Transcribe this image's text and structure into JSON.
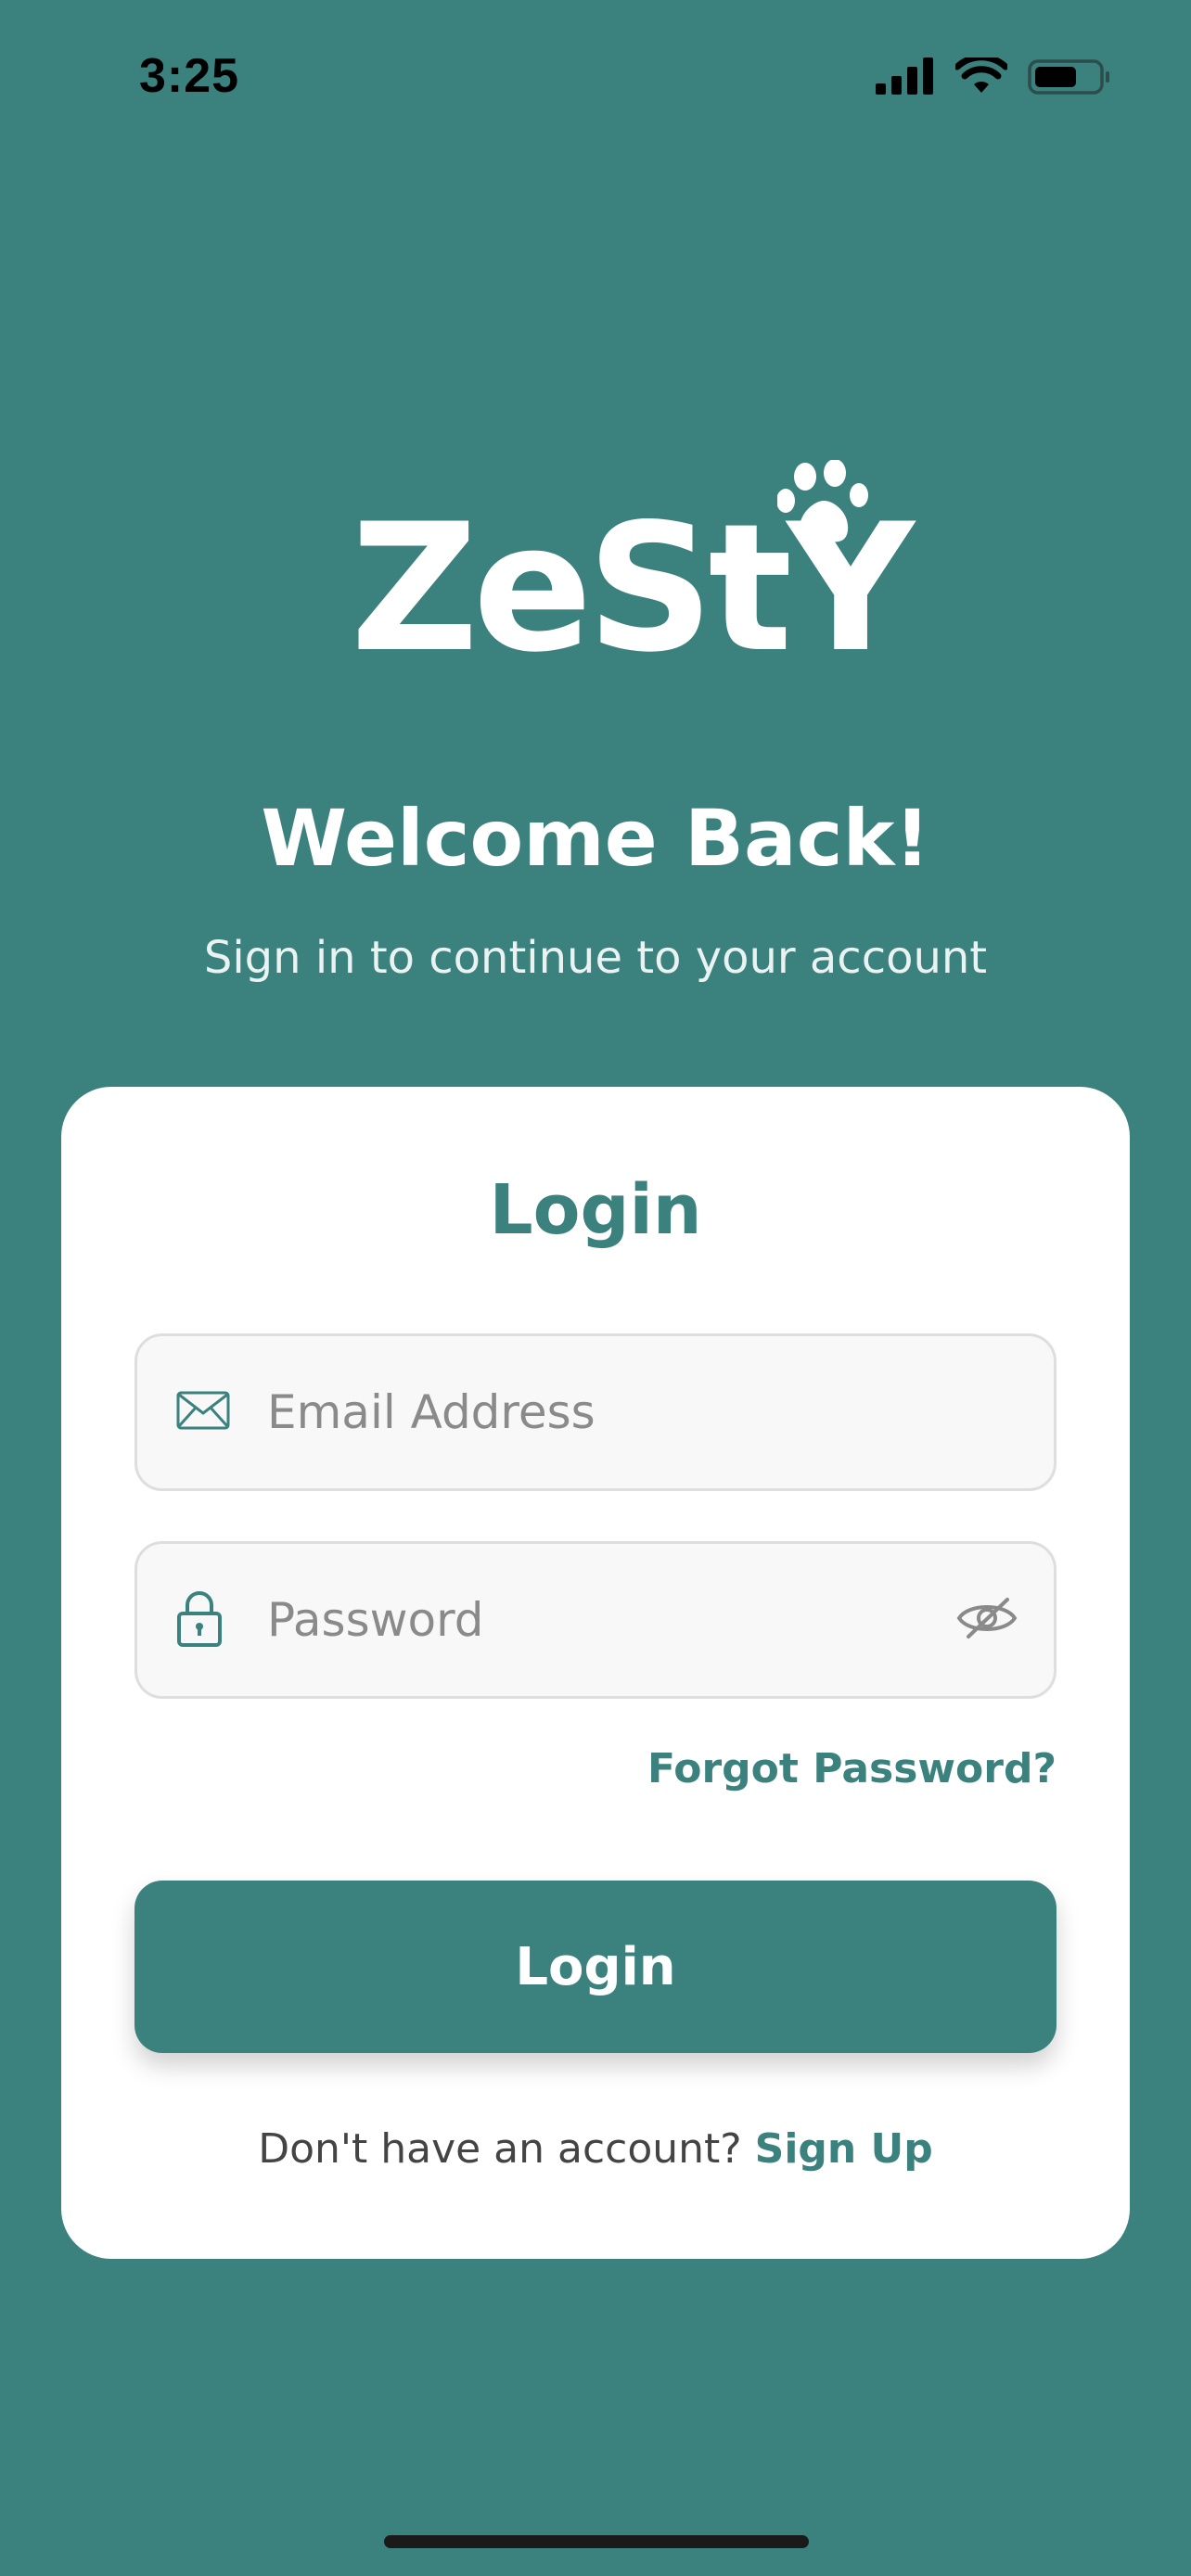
{
  "status_bar": {
    "time": "3:25"
  },
  "brand": {
    "logo_text": "ZeStY"
  },
  "header": {
    "welcome": "Welcome Back!",
    "subtitle": "Sign in to continue to your account"
  },
  "login_card": {
    "title": "Login",
    "email": {
      "placeholder": "Email Address",
      "icon": "mail-icon"
    },
    "password": {
      "placeholder": "Password",
      "icon": "lock-icon",
      "toggle_icon": "eye-off-icon"
    },
    "forgot_label": "Forgot Password?",
    "button_label": "Login",
    "signup_prompt": "Don't have an account? ",
    "signup_label": "Sign Up"
  },
  "colors": {
    "background": "#3b827f",
    "accent": "#3b827f",
    "card": "#ffffff"
  }
}
